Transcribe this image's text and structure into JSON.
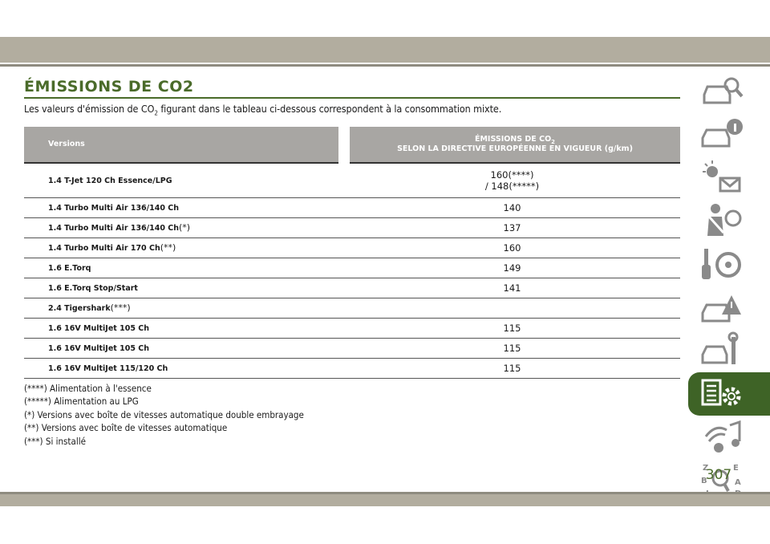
{
  "section": {
    "title": "ÉMISSIONS DE CO2",
    "intro_before": "Les valeurs d'émission de CO",
    "intro_sub": "2",
    "intro_after": "figurant dans le tableau ci-dessous correspondent à la consommation mixte."
  },
  "table": {
    "headers": {
      "versions": "Versions",
      "emissions_line1": "ÉMISSIONS DE CO",
      "emissions_sub": "2",
      "emissions_line2": "SELON LA DIRECTIVE EUROPÉENNE EN VIGUEUR (g/km)"
    },
    "rows": [
      {
        "version": "1.4 T-Jet 120 Ch Essence/LPG",
        "note": "",
        "emission": "160(****)",
        "emission2": "/ 148(*****)"
      },
      {
        "version": "1.4 Turbo Multi Air 136/140 Ch",
        "note": "",
        "emission": "140",
        "emission2": ""
      },
      {
        "version": "1.4 Turbo Multi Air 136/140 Ch",
        "note": "(*)",
        "emission": "137",
        "emission2": ""
      },
      {
        "version": "1.4 Turbo Multi Air 170 Ch",
        "note": "(**)",
        "emission": "160",
        "emission2": ""
      },
      {
        "version": "1.6 E.Torq",
        "note": "",
        "emission": "149",
        "emission2": ""
      },
      {
        "version": "1.6 E.Torq Stop/Start",
        "note": "",
        "emission": "141",
        "emission2": ""
      },
      {
        "version": "2.4 Tigershark",
        "note": "(***)",
        "emission": "",
        "emission2": ""
      },
      {
        "version": "1.6 16V MultiJet 105 Ch",
        "note": "",
        "emission": "115",
        "emission2": ""
      },
      {
        "version": "1.6 16V MultiJet 105 Ch",
        "note": "",
        "emission": "115",
        "emission2": ""
      },
      {
        "version": "1.6 16V MultiJet 115/120 Ch",
        "note": "",
        "emission": "115",
        "emission2": ""
      }
    ]
  },
  "notes": [
    "(****) Alimentation à l'essence",
    "(*****) Alimentation au LPG",
    "(*) Versions avec boîte de vitesses automatique double embrayage",
    "(**) Versions avec boîte de vitesses automatique",
    "(***) Si installé"
  ],
  "page_number": "307",
  "sidebar_icons": [
    "car-search-icon",
    "car-info-icon",
    "warning-light-message-icon",
    "airbag-seatbelt-icon",
    "key-steering-wheel-icon",
    "car-warning-icon",
    "car-wrench-icon",
    "specs-gear-icon",
    "multimedia-icon",
    "index-search-icon"
  ],
  "colors": {
    "accent": "#4a6b2a",
    "active_tab": "#3e6326",
    "header_bg": "#a8a6a3",
    "band": "#b2ad9f"
  }
}
